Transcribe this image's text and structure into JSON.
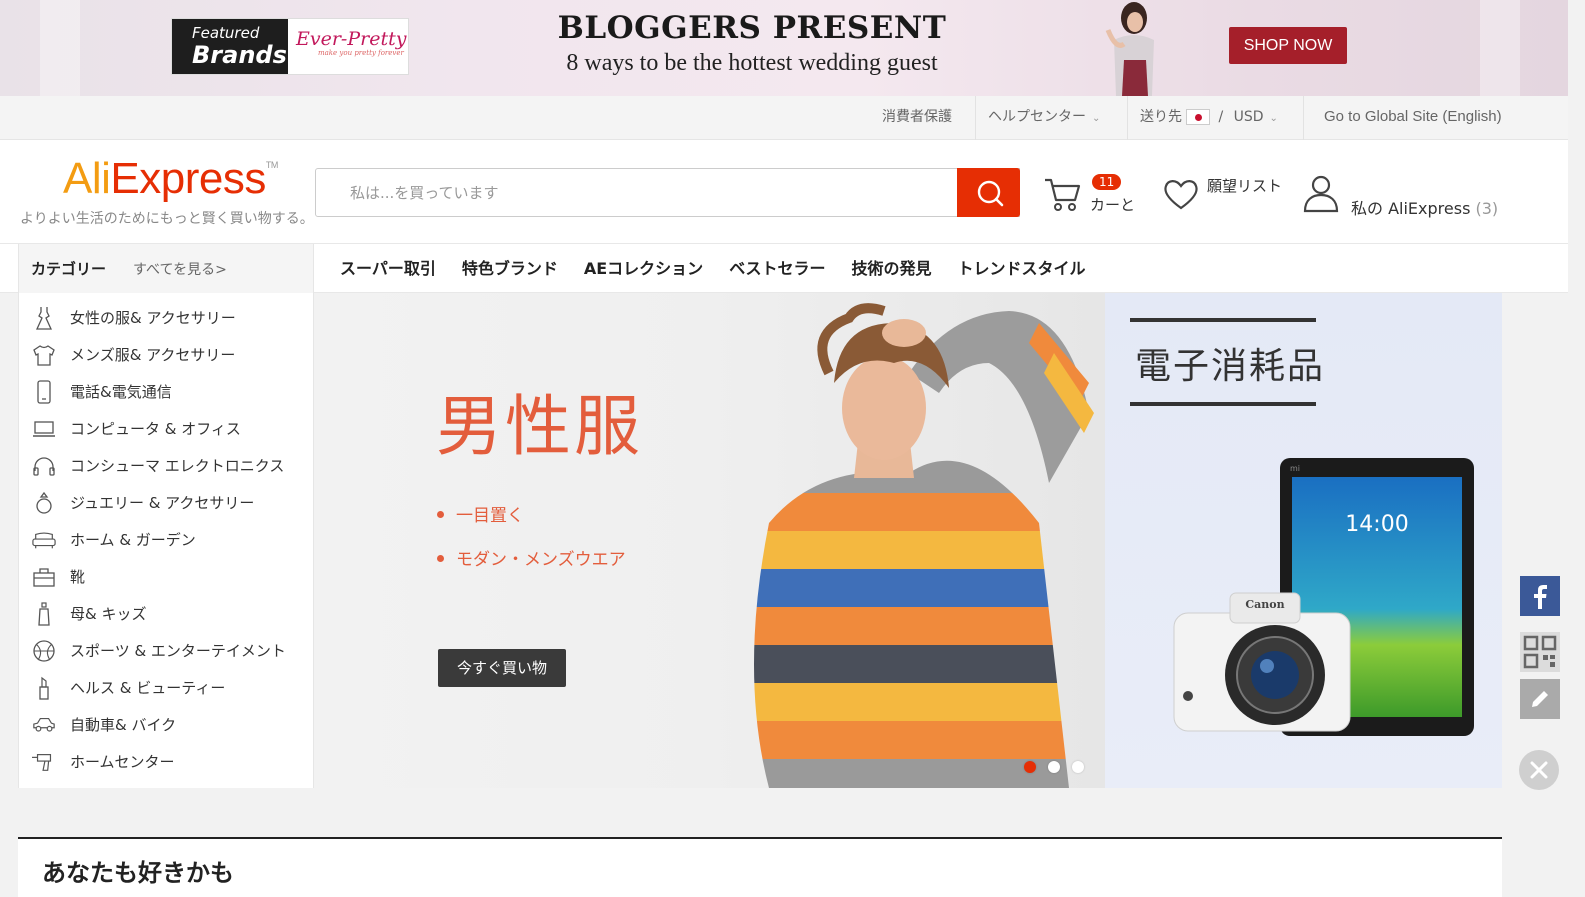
{
  "top_banner": {
    "featured_line1": "Featured",
    "featured_line2": "Brands",
    "brand_name": "Ever-Pretty",
    "brand_tagline": "make you pretty forever",
    "title": "BLOGGERS PRESENT",
    "subtitle": "8 ways to be the hottest wedding guest",
    "cta": "SHOP NOW"
  },
  "utility_bar": {
    "buyer_protection": "消費者保護",
    "help_center": "ヘルプセンター",
    "ship_to": "送り先",
    "separator": "/",
    "currency": "USD",
    "global_site": "Go to Global Site (English)"
  },
  "header": {
    "logo_ali": "Ali",
    "logo_express": "Express",
    "logo_tm": "TM",
    "tagline": "よりよい生活のためにもっと賢く買い物する。",
    "search_placeholder": "私は...を買っています",
    "cart_count": "11",
    "cart_label": "カーと",
    "wishlist_label": "願望リスト",
    "account_label": "私の AliExpress",
    "account_count": "(3)"
  },
  "nav": {
    "category_title": "カテゴリー",
    "see_all": "すべてを見る>",
    "links": [
      "スーパー取引",
      "特色ブランド",
      "AEコレクション",
      "ベストセラー",
      "技術の発見",
      "トレンドスタイル"
    ]
  },
  "categories": [
    {
      "label": "女性の服& アクセサリー",
      "icon": "dress-icon"
    },
    {
      "label": "メンズ服& アクセサリー",
      "icon": "shirt-icon"
    },
    {
      "label": "電話&電気通信",
      "icon": "phone-icon"
    },
    {
      "label": "コンピュータ & オフィス",
      "icon": "laptop-icon"
    },
    {
      "label": "コンシューマ エレクトロニクス",
      "icon": "headphones-icon"
    },
    {
      "label": "ジュエリー & アクセサリー",
      "icon": "ring-icon"
    },
    {
      "label": "ホーム & ガーデン",
      "icon": "sofa-icon"
    },
    {
      "label": "靴",
      "icon": "bag-icon"
    },
    {
      "label": "母& キッズ",
      "icon": "bottle-icon"
    },
    {
      "label": "スポーツ & エンターテイメント",
      "icon": "ball-icon"
    },
    {
      "label": "ヘルス & ビューティー",
      "icon": "lipstick-icon"
    },
    {
      "label": "自動車& バイク",
      "icon": "car-icon"
    },
    {
      "label": "ホームセンター",
      "icon": "drill-icon"
    }
  ],
  "hero": {
    "title": "男性服",
    "bullets": [
      "一目置く",
      "モダン・メンズウエア"
    ],
    "cta": "今すぐ買い物",
    "slides": 3,
    "active_slide": 1
  },
  "promo": {
    "title": "電子消耗品",
    "tablet_time": "14:00",
    "camera_brand": "Canon",
    "tablet_brand": "mi"
  },
  "recommendations": {
    "title": "あなたも好きかも"
  },
  "colors": {
    "accent": "#e62e04",
    "hero_text": "#e35d3c",
    "banner_cta": "#a51f2a"
  }
}
